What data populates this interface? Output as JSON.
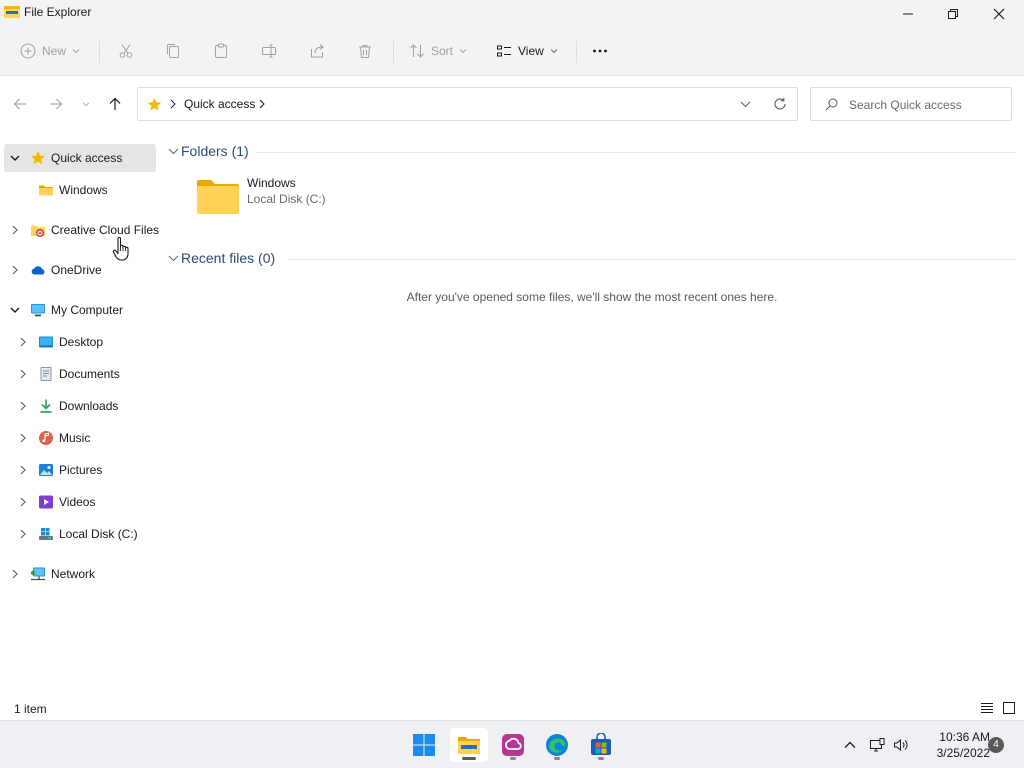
{
  "window": {
    "title": "File Explorer",
    "app_icon": "file-explorer-icon"
  },
  "toolbar": {
    "new_label": "New",
    "sort_label": "Sort",
    "view_label": "View",
    "icons": [
      "cut-icon",
      "copy-icon",
      "paste-icon",
      "rename-icon",
      "share-icon",
      "delete-icon",
      "more-icon"
    ]
  },
  "address": {
    "crumb": "Quick access",
    "search_placeholder": "Search Quick access"
  },
  "nav": {
    "items": [
      {
        "label": "Quick access",
        "icon": "star-icon",
        "selected": true
      },
      {
        "label": "Windows",
        "icon": "folder-icon"
      },
      {
        "label": "Creative Cloud Files",
        "icon": "creative-cloud-icon"
      },
      {
        "label": "OneDrive",
        "icon": "onedrive-icon"
      },
      {
        "label": "My Computer",
        "icon": "computer-icon"
      },
      {
        "label": "Desktop",
        "icon": "desktop-icon"
      },
      {
        "label": "Documents",
        "icon": "documents-icon"
      },
      {
        "label": "Downloads",
        "icon": "downloads-icon"
      },
      {
        "label": "Music",
        "icon": "music-icon"
      },
      {
        "label": "Pictures",
        "icon": "pictures-icon"
      },
      {
        "label": "Videos",
        "icon": "videos-icon"
      },
      {
        "label": "Local Disk (C:)",
        "icon": "drive-icon"
      },
      {
        "label": "Network",
        "icon": "network-icon"
      }
    ]
  },
  "content": {
    "folders_header": "Folders (1)",
    "folders": [
      {
        "name": "Windows",
        "location": "Local Disk (C:)"
      }
    ],
    "recent_header": "Recent files (0)",
    "recent_empty": "After you've opened some files, we'll show the most recent ones here."
  },
  "status": {
    "item_count": "1 item"
  },
  "taskbar": {
    "apps": [
      "start-icon",
      "file-explorer-icon",
      "creative-cloud-icon",
      "edge-icon",
      "store-icon"
    ],
    "time": "10:36 AM",
    "date": "3/25/2022",
    "notifications": "4"
  },
  "colors": {
    "accent": "#0078d4",
    "folder": "#f7c948",
    "group_header": "#2d4a7a"
  }
}
